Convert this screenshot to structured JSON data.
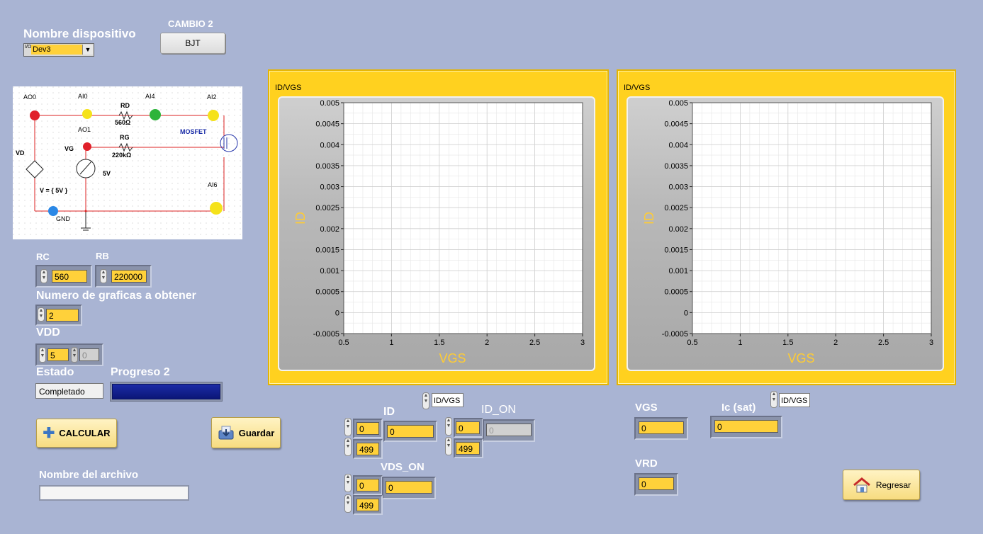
{
  "device": {
    "label": "Nombre dispositivo",
    "value": "Dev3",
    "prefix": "I/O"
  },
  "cambio": {
    "label": "CAMBIO 2",
    "button": "BJT"
  },
  "circuit": {
    "ao0": "AO0",
    "ai0": "AI0",
    "ai4": "AI4",
    "ai2": "AI2",
    "ao1": "AO1",
    "ai6": "AI6",
    "rd": "RD",
    "rd_val": "560Ω",
    "rg": "RG",
    "rg_val": "220kΩ",
    "vd": "VD",
    "vg": "VG",
    "vg_val": "5V",
    "v_eq": "V = { 5V }",
    "gnd": "GND",
    "mosfet": "MOSFET"
  },
  "rc": {
    "label": "RC",
    "value": "560"
  },
  "rb": {
    "label": "RB",
    "value": "220000"
  },
  "num_graphs": {
    "label": "Numero de graficas a obtener",
    "value": "2"
  },
  "vdd": {
    "label": "VDD",
    "value": "5",
    "value2": "0"
  },
  "estado": {
    "label": "Estado",
    "value": "Completado"
  },
  "progreso": {
    "label": "Progreso 2",
    "fraction": 1.0
  },
  "buttons": {
    "calcular": "CALCULAR",
    "guardar": "Guardar",
    "regresar": "Regresar"
  },
  "archivo": {
    "label": "Nombre del archivo",
    "value": ""
  },
  "graph_select": {
    "top": "ID/VGS",
    "right": "ID/VGS"
  },
  "id_block": {
    "label": "ID",
    "idx": "0",
    "len": "499",
    "value": "0"
  },
  "id_on_block": {
    "label": "ID_ON",
    "idx": "0",
    "len": "499",
    "value": "0"
  },
  "vds_on_block": {
    "label": "VDS_ON",
    "idx": "0",
    "len": "499",
    "value": "0"
  },
  "vgs": {
    "label": "VGS",
    "value": "0"
  },
  "ic_sat": {
    "label": "Ic (sat)",
    "value": "0"
  },
  "vrd": {
    "label": "VRD",
    "value": "0"
  },
  "colors": {
    "graph_frame": "#ffd11f",
    "field": "#ffd13a",
    "background": "#a9b4d3",
    "axis_label": "#ffcc33"
  },
  "chart_data": [
    {
      "type": "line",
      "title": "ID/VGS",
      "xlabel": "VGS",
      "ylabel": "ID",
      "xlim": [
        0.5,
        3
      ],
      "ylim": [
        -0.0005,
        0.005
      ],
      "xticks": [
        "0.5",
        "1",
        "1.5",
        "2",
        "2.5",
        "3"
      ],
      "yticks": [
        "0.005",
        "0.0045",
        "0.004",
        "0.0035",
        "0.003",
        "0.0025",
        "0.002",
        "0.0015",
        "0.001",
        "0.0005",
        "0",
        "-0.0005"
      ],
      "grid": true,
      "series": []
    },
    {
      "type": "line",
      "title": "ID/VGS",
      "xlabel": "VGS",
      "ylabel": "ID",
      "xlim": [
        0.5,
        3
      ],
      "ylim": [
        -0.0005,
        0.005
      ],
      "xticks": [
        "0.5",
        "1",
        "1.5",
        "2",
        "2.5",
        "3"
      ],
      "yticks": [
        "0.005",
        "0.0045",
        "0.004",
        "0.0035",
        "0.003",
        "0.0025",
        "0.002",
        "0.0015",
        "0.001",
        "0.0005",
        "0",
        "-0.0005"
      ],
      "grid": true,
      "series": []
    }
  ]
}
